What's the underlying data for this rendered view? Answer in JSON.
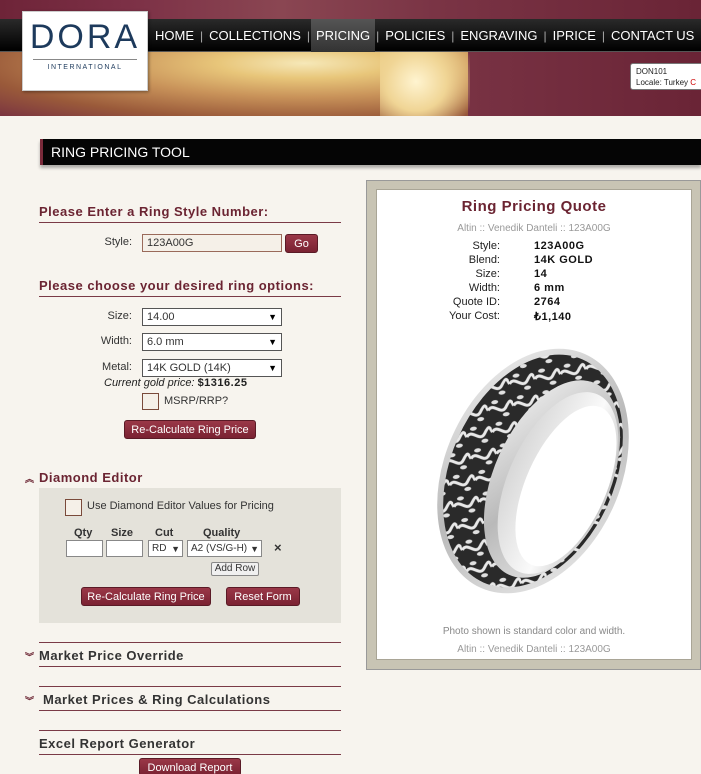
{
  "brand": {
    "name": "DORA",
    "sub": "INTERNATIONAL"
  },
  "nav": [
    "HOME",
    "COLLECTIONS",
    "PRICING",
    "POLICIES",
    "ENGRAVING",
    "IPRICE",
    "CONTACT US"
  ],
  "nav_active": "PRICING",
  "locale": {
    "account": "DON101",
    "label": "Locale: Turkey",
    "extra": "C"
  },
  "page_title": "RING PRICING TOOL",
  "style_section": {
    "heading": "Please Enter a Ring Style Number:",
    "style_label": "Style:",
    "style_value": "123A00G",
    "go_label": "Go"
  },
  "options_section": {
    "heading": "Please choose your desired ring options:",
    "size_label": "Size:",
    "size_value": "14.00",
    "width_label": "Width:",
    "width_value": "6.0 mm",
    "metal_label": "Metal:",
    "metal_value": "14K GOLD (14K)",
    "gold_price_label": "Current gold price:",
    "gold_price_value": "$1316.25",
    "msrp_label": "MSRP/RRP?",
    "recalc_label": "Re-Calculate Ring Price"
  },
  "diamond_editor": {
    "heading": "Diamond Editor",
    "use_label": "Use Diamond Editor Values for Pricing",
    "col_qty": "Qty",
    "col_size": "Size",
    "col_cut": "Cut",
    "col_quality": "Quality",
    "cut_value": "RD",
    "quality_value": "A2 (VS/G-H)",
    "remove_symbol": "×",
    "add_row_label": "Add Row",
    "recalc_label": "Re-Calculate Ring Price",
    "reset_label": "Reset Form"
  },
  "market_override": {
    "heading": "Market Price Override"
  },
  "market_calcs": {
    "heading": "Market Prices & Ring Calculations"
  },
  "excel": {
    "heading": "Excel Report Generator",
    "download_label": "Download Report"
  },
  "quote": {
    "title": "Ring Pricing Quote",
    "subtitle": "Altin :: Venedik Danteli :: 123A00G",
    "rows": [
      {
        "k": "Style:",
        "v": "123A00G"
      },
      {
        "k": "Blend:",
        "v": "14K GOLD"
      },
      {
        "k": "Size:",
        "v": "14"
      },
      {
        "k": "Width:",
        "v": "6 mm"
      },
      {
        "k": "Quote ID:",
        "v": "2764"
      },
      {
        "k": "Your Cost:",
        "v": "₺1,140"
      }
    ],
    "note": "Photo shown is standard color and width.",
    "subtitle2": "Altin :: Venedik Danteli :: 123A00G"
  },
  "colors": {
    "accent": "#6b2432",
    "button": "#8a2e3e",
    "header_bg": "#7a3046"
  }
}
